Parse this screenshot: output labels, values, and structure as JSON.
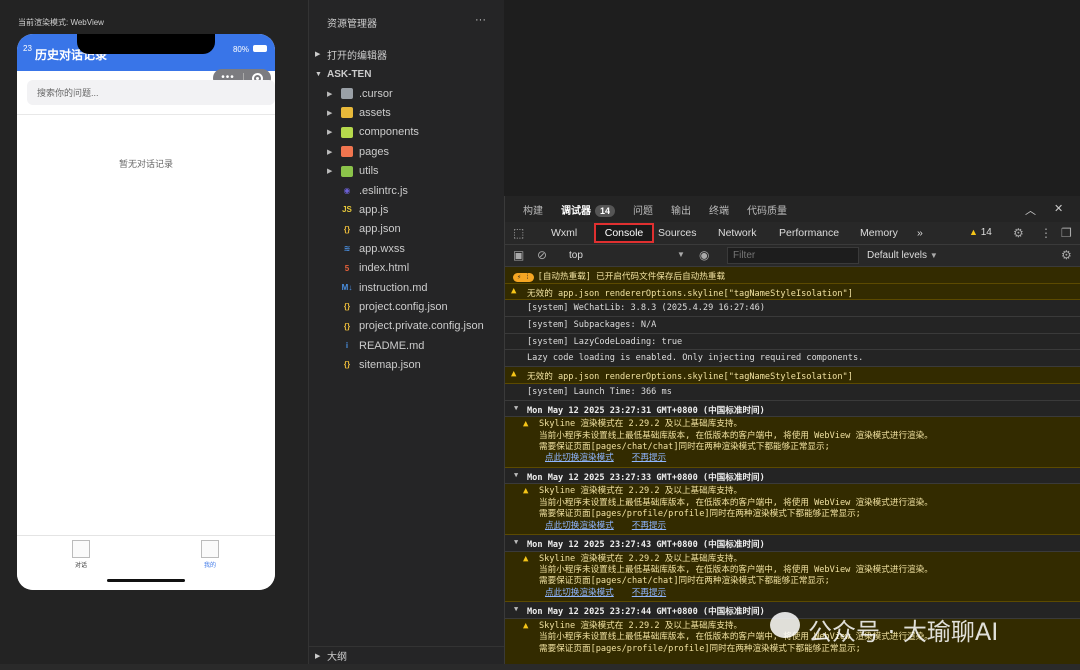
{
  "simulator": {
    "render_mode_label": "当前渲染模式: WebView",
    "status_time": "23",
    "battery": "80%",
    "page_title": "历史对话记录",
    "search_placeholder": "搜索你的问题...",
    "empty_text": "暂无对话记录",
    "tabs": [
      {
        "label": "对话",
        "active": false
      },
      {
        "label": "我的",
        "active": true
      }
    ],
    "brand_color": "#3975e8"
  },
  "explorer": {
    "title": "资源管理器",
    "open_editors": "打开的编辑器",
    "project": "ASK-TEN",
    "outline": "大纲",
    "items": [
      {
        "name": ".cursor",
        "icon": "folder-icon",
        "folder": true,
        "color": "#9aa0a6"
      },
      {
        "name": "assets",
        "icon": "folder-icon",
        "folder": true,
        "color": "#e8b93a"
      },
      {
        "name": "components",
        "icon": "folder-icon",
        "folder": true,
        "color": "#b6d94c"
      },
      {
        "name": "pages",
        "icon": "folder-icon",
        "folder": true,
        "color": "#f0754f"
      },
      {
        "name": "utils",
        "icon": "folder-icon",
        "folder": true,
        "color": "#8bc34a"
      },
      {
        "name": ".eslintrc.js",
        "icon": "eslint-icon",
        "folder": false,
        "color": "#6b5fd3",
        "glyph": "◉"
      },
      {
        "name": "app.js",
        "icon": "js-icon",
        "folder": false,
        "color": "#e8c93a",
        "glyph": "JS"
      },
      {
        "name": "app.json",
        "icon": "json-icon",
        "folder": false,
        "color": "#e8b93a",
        "glyph": "{}"
      },
      {
        "name": "app.wxss",
        "icon": "css-icon",
        "folder": false,
        "color": "#4a90e2",
        "glyph": "≋"
      },
      {
        "name": "index.html",
        "icon": "html-icon",
        "folder": false,
        "color": "#e8613a",
        "glyph": "5"
      },
      {
        "name": "instruction.md",
        "icon": "markdown-icon",
        "folder": false,
        "color": "#4a90e2",
        "glyph": "M↓"
      },
      {
        "name": "project.config.json",
        "icon": "json-icon",
        "folder": false,
        "color": "#e8b93a",
        "glyph": "{}"
      },
      {
        "name": "project.private.config.json",
        "icon": "json-icon",
        "folder": false,
        "color": "#e8b93a",
        "glyph": "{}"
      },
      {
        "name": "README.md",
        "icon": "info-icon",
        "folder": false,
        "color": "#4a90e2",
        "glyph": "i"
      },
      {
        "name": "sitemap.json",
        "icon": "json-icon",
        "folder": false,
        "color": "#e8b93a",
        "glyph": "{}"
      }
    ]
  },
  "devtools": {
    "tabs": [
      {
        "label": "构建",
        "active": false
      },
      {
        "label": "调试器",
        "active": true,
        "badge": "14"
      },
      {
        "label": "问题",
        "active": false
      },
      {
        "label": "输出",
        "active": false
      },
      {
        "label": "终端",
        "active": false
      },
      {
        "label": "代码质量",
        "active": false
      }
    ],
    "panel_tabs": [
      "Wxml",
      "Console",
      "Sources",
      "Network",
      "Performance",
      "Memory"
    ],
    "more": "»",
    "warn_count": "14",
    "context": "top",
    "filter_placeholder": "Filter",
    "levels": "Default levels",
    "hot_badge": "⚡ ⁞",
    "logs": [
      {
        "type": "hot",
        "text": "[自动热重载] 已开启代码文件保存后自动热重载"
      },
      {
        "type": "warn",
        "text": "无效的 app.json rendererOptions.skyline[\"tagNameStyleIsolation\"]"
      },
      {
        "type": "info",
        "text": "[system] WeChatLib: 3.8.3 (2025.4.29 16:27:46)"
      },
      {
        "type": "info",
        "text": "[system] Subpackages: N/A"
      },
      {
        "type": "info",
        "text": "[system] LazyCodeLoading: true"
      },
      {
        "type": "info",
        "text": "Lazy code loading is enabled. Only injecting required components."
      },
      {
        "type": "warn",
        "text": "无效的 app.json rendererOptions.skyline[\"tagNameStyleIsolation\"]"
      },
      {
        "type": "info",
        "text": "[system] Launch Time: 366 ms"
      }
    ],
    "groups": [
      {
        "head": "Mon May 12 2025 23:27:31 GMT+0800 (中国标准时间)",
        "l1": "Skyline 渲染模式在 2.29.2 及以上基础库支持。",
        "l2": "当前小程序未设置线上最低基础库版本, 在低版本的客户端中, 将使用 WebView 渲染模式进行渲染。",
        "l3": "需要保证页面[pages/chat/chat]同时在两种渲染模式下都能够正常显示;",
        "link1": "点此切换渲染模式",
        "link2": "不再提示"
      },
      {
        "head": "Mon May 12 2025 23:27:33 GMT+0800 (中国标准时间)",
        "l1": "Skyline 渲染模式在 2.29.2 及以上基础库支持。",
        "l2": "当前小程序未设置线上最低基础库版本, 在低版本的客户端中, 将使用 WebView 渲染模式进行渲染。",
        "l3": "需要保证页面[pages/profile/profile]同时在两种渲染模式下都能够正常显示;",
        "link1": "点此切换渲染模式",
        "link2": "不再提示"
      },
      {
        "head": "Mon May 12 2025 23:27:43 GMT+0800 (中国标准时间)",
        "l1": "Skyline 渲染模式在 2.29.2 及以上基础库支持。",
        "l2": "当前小程序未设置线上最低基础库版本, 在低版本的客户端中, 将使用 WebView 渲染模式进行渲染。",
        "l3": "需要保证页面[pages/chat/chat]同时在两种渲染模式下都能够正常显示;",
        "link1": "点此切换渲染模式",
        "link2": "不再提示"
      },
      {
        "head": "Mon May 12 2025 23:27:44 GMT+0800 (中国标准时间)",
        "l1": "Skyline 渲染模式在 2.29.2 及以上基础库支持。",
        "l2": "当前小程序未设置线上最低基础库版本, 在低版本的客户端中, 将使用 WebView 渲染模式进行渲染。",
        "l3": "需要保证页面[pages/profile/profile]同时在两种渲染模式下都能够正常显示;",
        "link1": "",
        "link2": ""
      }
    ]
  },
  "watermark": "公众号 · 大瑜聊AI"
}
